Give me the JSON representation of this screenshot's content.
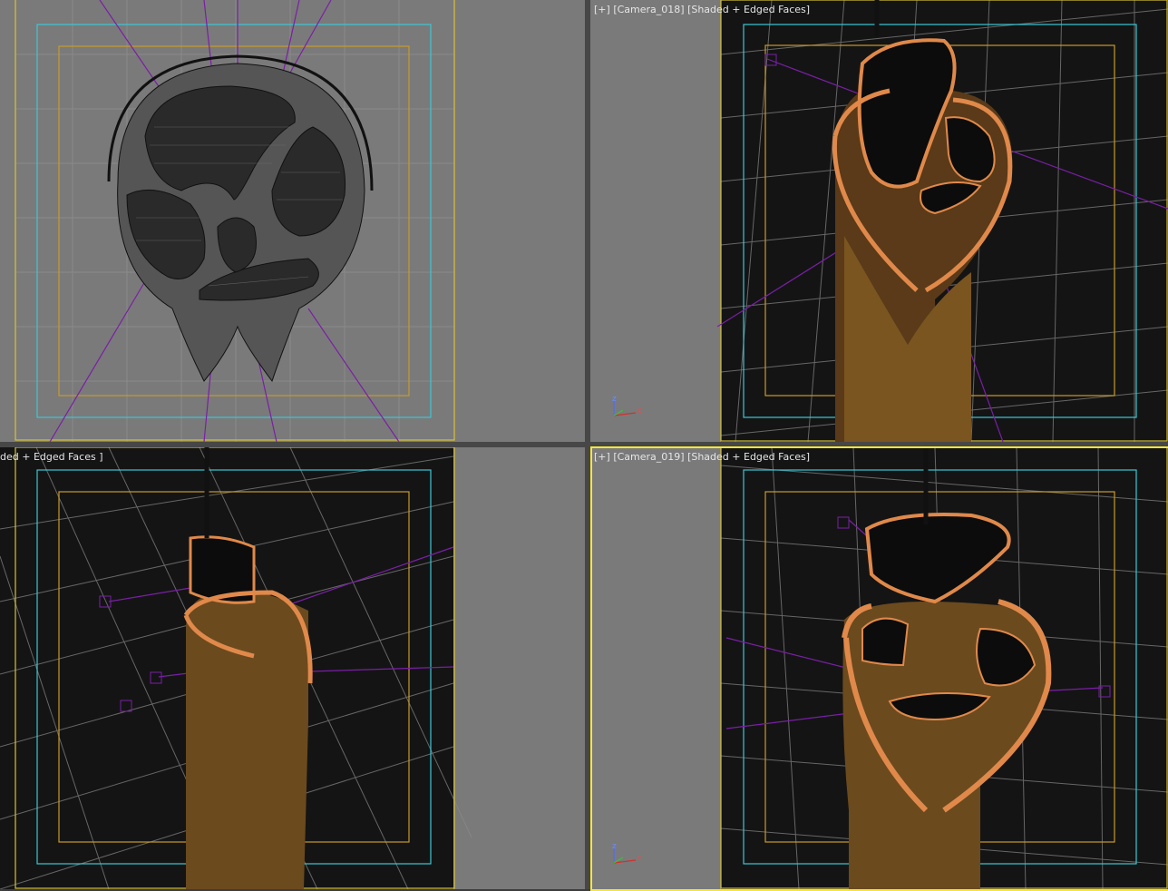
{
  "viewports": {
    "top_left": {
      "label_plus": "",
      "label_camera": "",
      "label_shading": ""
    },
    "top_right": {
      "label_plus": "[+]",
      "label_camera": "[Camera_018]",
      "label_shading": "[Shaded + Edged Faces]"
    },
    "bottom_left": {
      "label_shading": "ded + Edged Faces ]"
    },
    "bottom_right": {
      "label_plus": "[+]",
      "label_camera": "[Camera_019]",
      "label_shading": "[Shaded + Edged Faces]"
    }
  },
  "axis_tripod": {
    "z": "z",
    "x": "x"
  },
  "colors": {
    "viewport_bg_gray": "#7a7a7a",
    "shaded_bg": "#141414",
    "active_border": "#f5e63a",
    "safe_frame_cyan": "#3ac7d6",
    "safe_frame_gold": "#c89a2a",
    "light_lines": "#7a1fa6",
    "mesh_orange": "#e0894a"
  }
}
